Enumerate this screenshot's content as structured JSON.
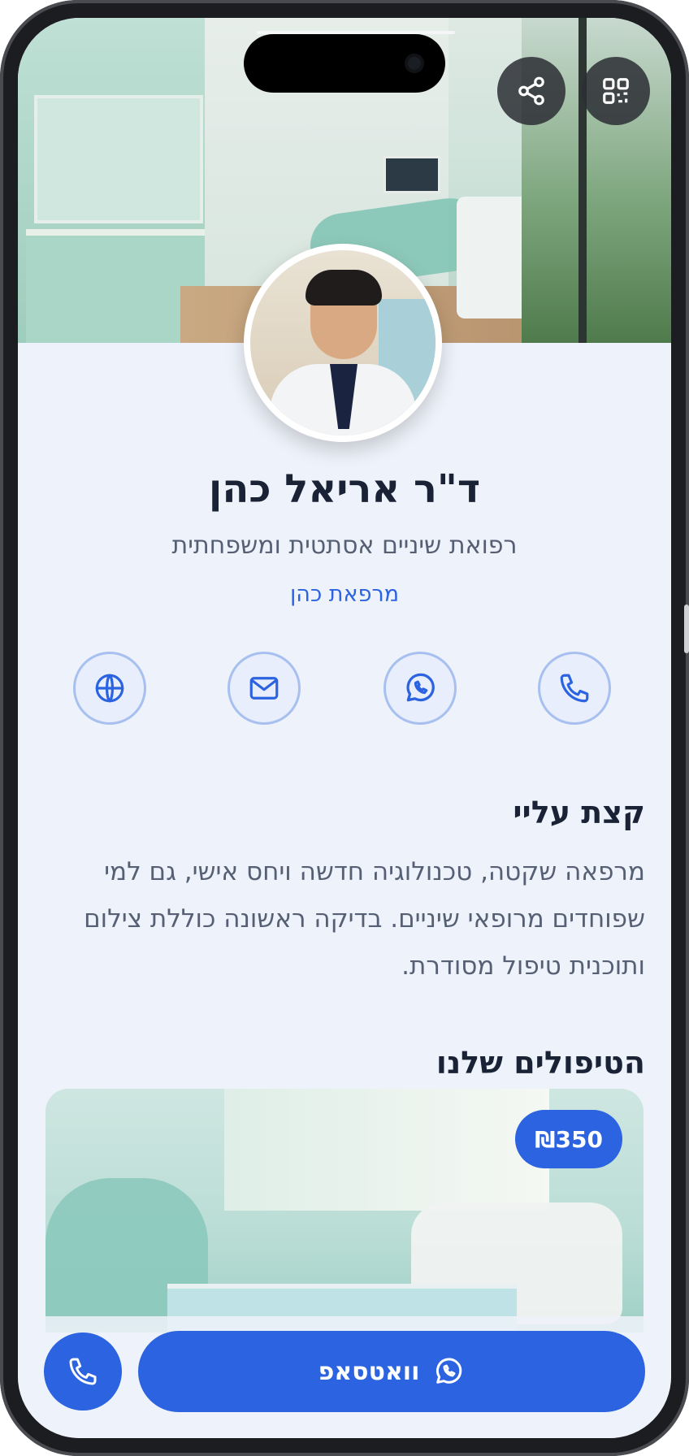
{
  "profile": {
    "name": "ד\"ר אריאל כהן",
    "subtitle": "רפואת שיניים אסתטית ומשפחתית",
    "clinic": "מרפאת כהן"
  },
  "contact_icons": [
    "phone-icon",
    "whatsapp-icon",
    "mail-icon",
    "globe-icon"
  ],
  "about": {
    "title": "קצת עליי",
    "text": "מרפאה שקטה, טכנולוגיה חדשה ויחס אישי, גם למי שפוחדים מרופאי שיניים. בדיקה ראשונה כוללת צילום ותוכנית טיפול מסודרת."
  },
  "services": {
    "title": "הטיפולים שלנו",
    "items": [
      {
        "price": "₪350"
      }
    ]
  },
  "bottom_bar": {
    "whatsapp_label": "וואטסאפ"
  },
  "colors": {
    "accent": "#2b63e0",
    "heading": "#1a2236",
    "body_text": "#566074",
    "background": "#eef2fa"
  }
}
